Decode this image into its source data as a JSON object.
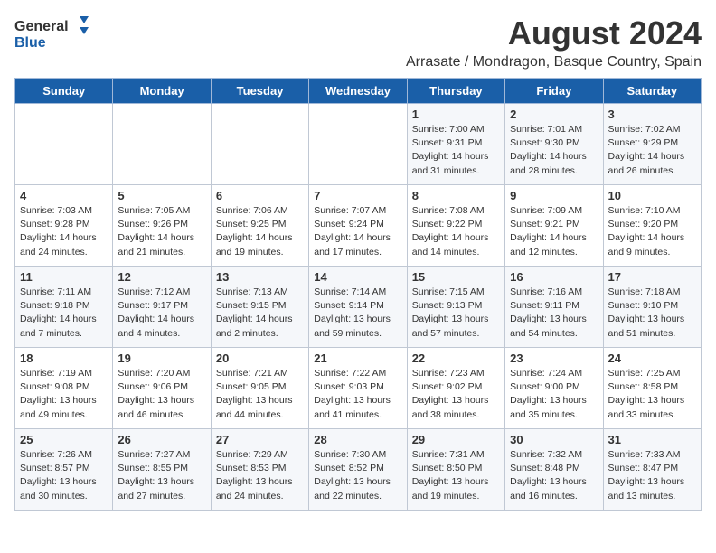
{
  "logo": {
    "general": "General",
    "blue": "Blue"
  },
  "header": {
    "month_year": "August 2024",
    "location": "Arrasate / Mondragon, Basque Country, Spain"
  },
  "days_of_week": [
    "Sunday",
    "Monday",
    "Tuesday",
    "Wednesday",
    "Thursday",
    "Friday",
    "Saturday"
  ],
  "weeks": [
    [
      {
        "day": "",
        "detail": ""
      },
      {
        "day": "",
        "detail": ""
      },
      {
        "day": "",
        "detail": ""
      },
      {
        "day": "",
        "detail": ""
      },
      {
        "day": "1",
        "detail": "Sunrise: 7:00 AM\nSunset: 9:31 PM\nDaylight: 14 hours\nand 31 minutes."
      },
      {
        "day": "2",
        "detail": "Sunrise: 7:01 AM\nSunset: 9:30 PM\nDaylight: 14 hours\nand 28 minutes."
      },
      {
        "day": "3",
        "detail": "Sunrise: 7:02 AM\nSunset: 9:29 PM\nDaylight: 14 hours\nand 26 minutes."
      }
    ],
    [
      {
        "day": "4",
        "detail": "Sunrise: 7:03 AM\nSunset: 9:28 PM\nDaylight: 14 hours\nand 24 minutes."
      },
      {
        "day": "5",
        "detail": "Sunrise: 7:05 AM\nSunset: 9:26 PM\nDaylight: 14 hours\nand 21 minutes."
      },
      {
        "day": "6",
        "detail": "Sunrise: 7:06 AM\nSunset: 9:25 PM\nDaylight: 14 hours\nand 19 minutes."
      },
      {
        "day": "7",
        "detail": "Sunrise: 7:07 AM\nSunset: 9:24 PM\nDaylight: 14 hours\nand 17 minutes."
      },
      {
        "day": "8",
        "detail": "Sunrise: 7:08 AM\nSunset: 9:22 PM\nDaylight: 14 hours\nand 14 minutes."
      },
      {
        "day": "9",
        "detail": "Sunrise: 7:09 AM\nSunset: 9:21 PM\nDaylight: 14 hours\nand 12 minutes."
      },
      {
        "day": "10",
        "detail": "Sunrise: 7:10 AM\nSunset: 9:20 PM\nDaylight: 14 hours\nand 9 minutes."
      }
    ],
    [
      {
        "day": "11",
        "detail": "Sunrise: 7:11 AM\nSunset: 9:18 PM\nDaylight: 14 hours\nand 7 minutes."
      },
      {
        "day": "12",
        "detail": "Sunrise: 7:12 AM\nSunset: 9:17 PM\nDaylight: 14 hours\nand 4 minutes."
      },
      {
        "day": "13",
        "detail": "Sunrise: 7:13 AM\nSunset: 9:15 PM\nDaylight: 14 hours\nand 2 minutes."
      },
      {
        "day": "14",
        "detail": "Sunrise: 7:14 AM\nSunset: 9:14 PM\nDaylight: 13 hours\nand 59 minutes."
      },
      {
        "day": "15",
        "detail": "Sunrise: 7:15 AM\nSunset: 9:13 PM\nDaylight: 13 hours\nand 57 minutes."
      },
      {
        "day": "16",
        "detail": "Sunrise: 7:16 AM\nSunset: 9:11 PM\nDaylight: 13 hours\nand 54 minutes."
      },
      {
        "day": "17",
        "detail": "Sunrise: 7:18 AM\nSunset: 9:10 PM\nDaylight: 13 hours\nand 51 minutes."
      }
    ],
    [
      {
        "day": "18",
        "detail": "Sunrise: 7:19 AM\nSunset: 9:08 PM\nDaylight: 13 hours\nand 49 minutes."
      },
      {
        "day": "19",
        "detail": "Sunrise: 7:20 AM\nSunset: 9:06 PM\nDaylight: 13 hours\nand 46 minutes."
      },
      {
        "day": "20",
        "detail": "Sunrise: 7:21 AM\nSunset: 9:05 PM\nDaylight: 13 hours\nand 44 minutes."
      },
      {
        "day": "21",
        "detail": "Sunrise: 7:22 AM\nSunset: 9:03 PM\nDaylight: 13 hours\nand 41 minutes."
      },
      {
        "day": "22",
        "detail": "Sunrise: 7:23 AM\nSunset: 9:02 PM\nDaylight: 13 hours\nand 38 minutes."
      },
      {
        "day": "23",
        "detail": "Sunrise: 7:24 AM\nSunset: 9:00 PM\nDaylight: 13 hours\nand 35 minutes."
      },
      {
        "day": "24",
        "detail": "Sunrise: 7:25 AM\nSunset: 8:58 PM\nDaylight: 13 hours\nand 33 minutes."
      }
    ],
    [
      {
        "day": "25",
        "detail": "Sunrise: 7:26 AM\nSunset: 8:57 PM\nDaylight: 13 hours\nand 30 minutes."
      },
      {
        "day": "26",
        "detail": "Sunrise: 7:27 AM\nSunset: 8:55 PM\nDaylight: 13 hours\nand 27 minutes."
      },
      {
        "day": "27",
        "detail": "Sunrise: 7:29 AM\nSunset: 8:53 PM\nDaylight: 13 hours\nand 24 minutes."
      },
      {
        "day": "28",
        "detail": "Sunrise: 7:30 AM\nSunset: 8:52 PM\nDaylight: 13 hours\nand 22 minutes."
      },
      {
        "day": "29",
        "detail": "Sunrise: 7:31 AM\nSunset: 8:50 PM\nDaylight: 13 hours\nand 19 minutes."
      },
      {
        "day": "30",
        "detail": "Sunrise: 7:32 AM\nSunset: 8:48 PM\nDaylight: 13 hours\nand 16 minutes."
      },
      {
        "day": "31",
        "detail": "Sunrise: 7:33 AM\nSunset: 8:47 PM\nDaylight: 13 hours\nand 13 minutes."
      }
    ]
  ]
}
